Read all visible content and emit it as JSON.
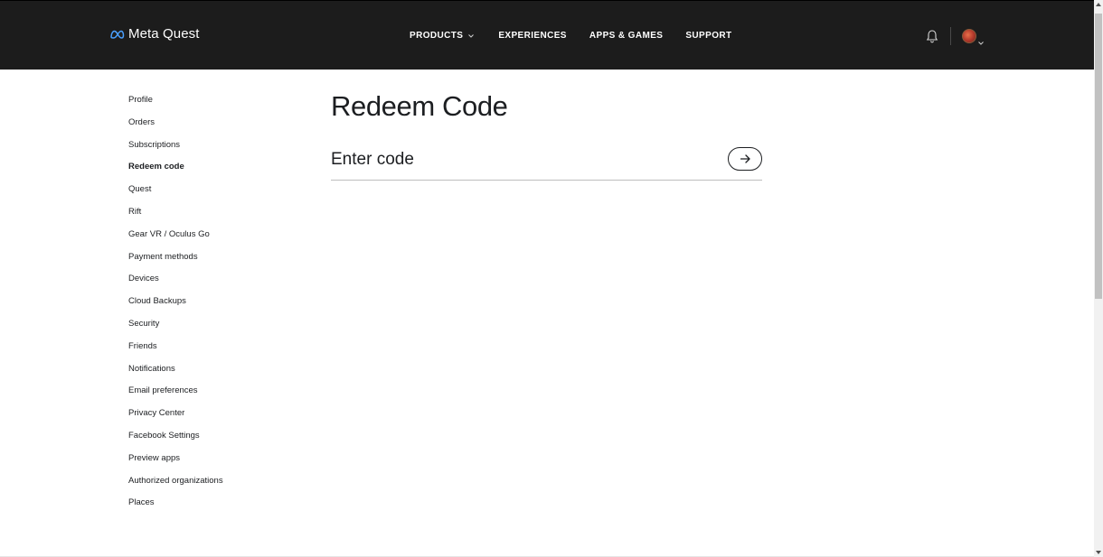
{
  "header": {
    "logo_text": "Meta Quest",
    "nav": [
      {
        "label": "PRODUCTS",
        "has_dropdown": true
      },
      {
        "label": "EXPERIENCES",
        "has_dropdown": false
      },
      {
        "label": "APPS & GAMES",
        "has_dropdown": false
      },
      {
        "label": "SUPPORT",
        "has_dropdown": false
      }
    ],
    "icons": {
      "notifications": "bell-icon",
      "avatar": "avatar",
      "avatar_menu": "chevron-down-icon"
    }
  },
  "sidebar": {
    "items": [
      {
        "label": "Profile",
        "active": false
      },
      {
        "label": "Orders",
        "active": false
      },
      {
        "label": "Subscriptions",
        "active": false
      },
      {
        "label": "Redeem code",
        "active": true
      },
      {
        "label": "Quest",
        "active": false
      },
      {
        "label": "Rift",
        "active": false
      },
      {
        "label": "Gear VR / Oculus Go",
        "active": false
      },
      {
        "label": "Payment methods",
        "active": false
      },
      {
        "label": "Devices",
        "active": false
      },
      {
        "label": "Cloud Backups",
        "active": false
      },
      {
        "label": "Security",
        "active": false
      },
      {
        "label": "Friends",
        "active": false
      },
      {
        "label": "Notifications",
        "active": false
      },
      {
        "label": "Email preferences",
        "active": false
      },
      {
        "label": "Privacy Center",
        "active": false
      },
      {
        "label": "Facebook Settings",
        "active": false
      },
      {
        "label": "Preview apps",
        "active": false
      },
      {
        "label": "Authorized organizations",
        "active": false
      },
      {
        "label": "Places",
        "active": false
      }
    ]
  },
  "main": {
    "title": "Redeem Code",
    "code_input": {
      "placeholder": "Enter code",
      "value": ""
    },
    "submit_icon": "arrow-right-icon"
  },
  "colors": {
    "header_bg": "#1c1c1c",
    "text": "#1c1e21",
    "page_bg": "#ffffff"
  }
}
